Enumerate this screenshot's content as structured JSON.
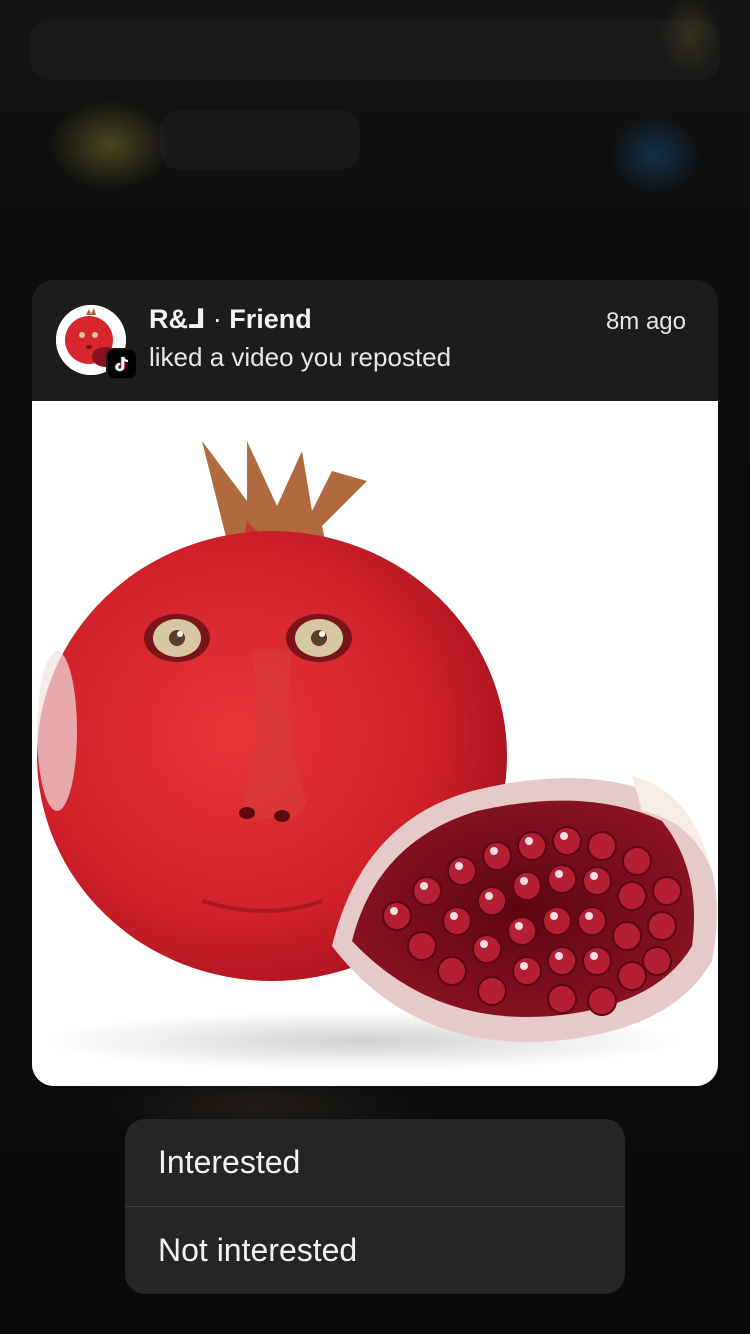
{
  "notification": {
    "sender_name": "R&⅃",
    "relation": "Friend",
    "separator": "·",
    "action": "liked a video you reposted",
    "time": "8m ago",
    "app_icon": "tiktok-icon",
    "media_subject": "pomegranate-with-face"
  },
  "context_menu": {
    "items": [
      {
        "label": "Interested"
      },
      {
        "label": "Not interested"
      }
    ]
  },
  "colors": {
    "card_bg": "#1c1c1e",
    "menu_bg": "#252527",
    "text": "#f2f2f2",
    "backdrop": "#0c0c0c"
  }
}
